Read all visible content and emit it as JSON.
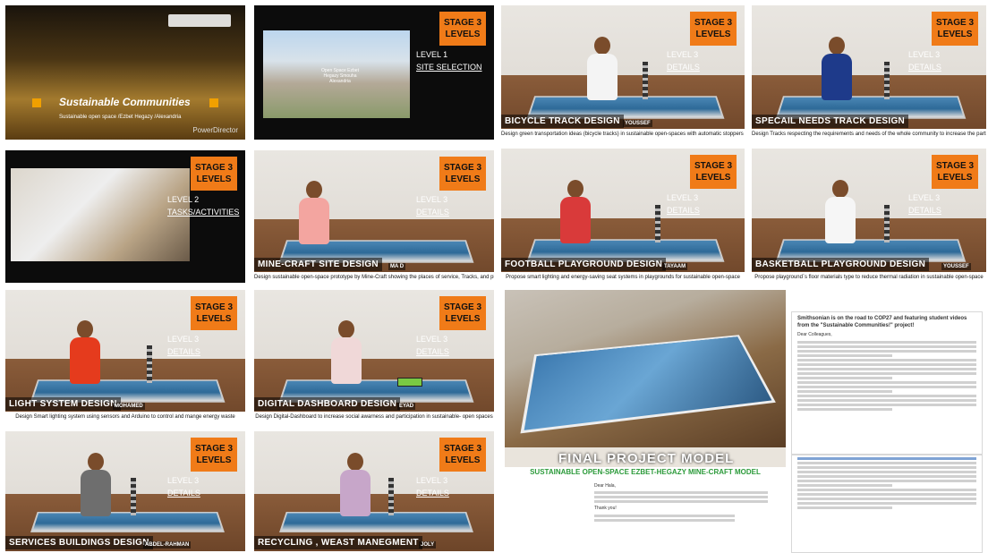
{
  "stage_label": [
    "STAGE 3",
    "LEVELS"
  ],
  "intro": {
    "title": "Sustainable Communities",
    "subtitle": "Sustainable open space /Ezbet Hegazy /Alexandria",
    "watermark": "PowerDirector"
  },
  "site": {
    "level": "LEVEL 1",
    "detail": "SITE SELECTION",
    "overlay": "Open Space Ezbet Hegazy Smouha Alexandria"
  },
  "tasks": {
    "level": "LEVEL 2",
    "detail": "TASKS/ACTIVITIES"
  },
  "tiles": [
    {
      "id": "bicycle",
      "level": "LEVEL 3",
      "detail": "DETAILS",
      "title": "BICYCLE TRACK DESIGN",
      "name": "YOUSSEF",
      "caption": "Design green transportation ideas (bicycle tracks) in sustainable open-spaces with automatic stoppers to increase safety"
    },
    {
      "id": "special",
      "level": "LEVEL 3",
      "detail": "DETAILS",
      "title": "SPECAIL NEEDS TRACK DESIGN",
      "name": "",
      "caption": "Design Tracks respecting the requirements and needs of the whole community to increase the participation and equality in sustainable open- sapace"
    },
    {
      "id": "minecraft",
      "level": "LEVEL 3",
      "detail": "DETAILS",
      "title": "MINE-CRAFT SITE DESIGN",
      "name": "MA D",
      "caption": "Design sustainable open-space prototype by Mine-Craft showing the places of service, Tracks, and playgrounds"
    },
    {
      "id": "football",
      "level": "LEVEL 3",
      "detail": "DETAILS",
      "title": "FOOTBALL PLAYGROUND DESIGN",
      "name": "TAYAAM",
      "caption": "Propose smart lighting and energy-saving seat systems in playgrounds for sustainable open-space"
    },
    {
      "id": "basketball",
      "level": "LEVEL 3",
      "detail": "DETAILS",
      "title": "BASKETBALL PLAYGROUND DESIGN",
      "name": "YOUSSEF",
      "caption": "Propose playground`s floor materials type to reduce thermal radiation in sustainable open-space"
    },
    {
      "id": "light",
      "level": "LEVEL 3",
      "detail": "DETAILS",
      "title": "LIGHT SYSTEM DESIGN",
      "name": "MOHAMED",
      "caption": "Design Smart lighting system using sensors and Arduino to control and mange energy waste"
    },
    {
      "id": "dashboard",
      "level": "LEVEL 3",
      "detail": "DETAILS",
      "title": "DIGITAL DASHBOARD DESIGN",
      "name": "EYAD",
      "caption": "Design Digital-Dashboard to increase social awarness and participation in sustainable- open spaces"
    },
    {
      "id": "services",
      "level": "LEVEL 3",
      "detail": "DETAILS",
      "title": "SERVICES BUILDINGS DESIGN",
      "name": "ABDEL-RAHMAN",
      "caption": ""
    },
    {
      "id": "recycling",
      "level": "LEVEL 3",
      "detail": "DETAILS",
      "title": "RECYCLING , WEAST MANEGMENT",
      "name": "JOLY",
      "caption": ""
    }
  ],
  "final": {
    "title": "FINAL PROJECT MODEL",
    "subtitle": "SUSTAINABLE OPEN-SPACE EZBET-HEGAZY MINE-CRAFT MODEL"
  },
  "email": {
    "subject": "Smithsonian is on the road to COP27 and featuring student videos from the \"Sustainable Communities!\" project!",
    "greeting": "Dear Colleagues,",
    "letter_greeting": "Dear Hala,",
    "letter_close": "Thank you!"
  },
  "colors": {
    "stage": "#f07b18",
    "background": "#0c0c0c"
  }
}
